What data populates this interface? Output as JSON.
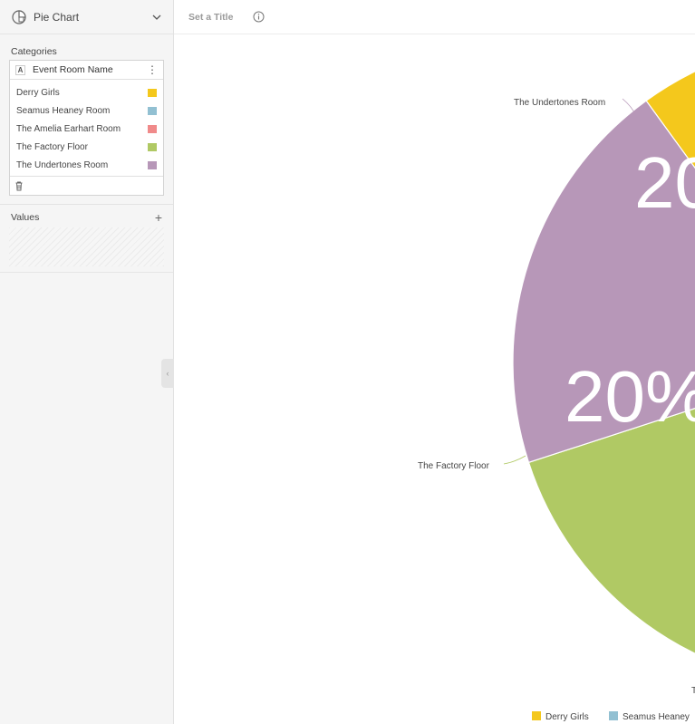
{
  "sidebar": {
    "chart_type": "Pie Chart",
    "categories_title": "Categories",
    "category_field": "Event Room Name",
    "values_title": "Values"
  },
  "header": {
    "title_placeholder": "Set a Title"
  },
  "colors": {
    "derry": "#f4c81c",
    "seamus": "#92c0d2",
    "amelia": "#f08a8a",
    "factory": "#b0c964",
    "undertones": "#b797b8"
  },
  "chart_data": {
    "type": "pie",
    "title": "",
    "categories": [
      "Derry Girls",
      "Seamus Heaney Room",
      "The Amelia Earhart Room",
      "The Factory Floor",
      "The Undertones Room"
    ],
    "values": [
      20,
      20,
      20,
      20,
      20
    ],
    "colors": [
      "#f4c81c",
      "#92c0d2",
      "#f08a8a",
      "#b0c964",
      "#b797b8"
    ],
    "visible_percent_labels": [
      "20%",
      "20%"
    ],
    "legend": [
      "Derry Girls",
      "Seamus Heaney"
    ]
  },
  "labels": {
    "undertones": "The Undertones Room",
    "factory": "The Factory Floor",
    "amelia_cut": "T",
    "pct_undertones": "20",
    "pct_factory": "20%"
  }
}
